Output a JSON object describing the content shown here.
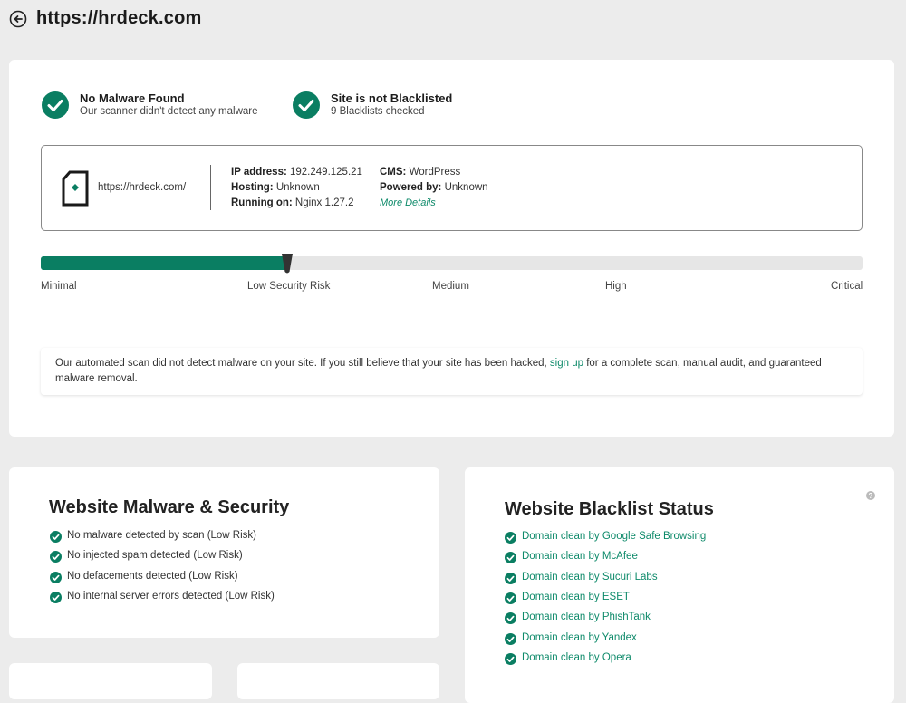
{
  "header": {
    "title": "https://hrdeck.com",
    "back_icon": "back-arrow-icon"
  },
  "status": {
    "malware": {
      "title": "No Malware Found",
      "subtitle": "Our scanner didn't detect any malware",
      "icon": "check-circle-icon"
    },
    "blacklist": {
      "title": "Site is not Blacklisted",
      "subtitle": "9 Blacklists checked",
      "icon": "check-circle-icon"
    }
  },
  "site_info": {
    "url": "https://hrdeck.com/",
    "ip_label": "IP address:",
    "ip_value": "192.249.125.21",
    "hosting_label": "Hosting:",
    "hosting_value": "Unknown",
    "running_label": "Running on:",
    "running_value": "Nginx 1.27.2",
    "cms_label": "CMS:",
    "cms_value": "WordPress",
    "powered_label": "Powered by:",
    "powered_value": "Unknown",
    "more_details": "More Details"
  },
  "risk": {
    "levels": [
      "Minimal",
      "Low Security Risk",
      "Medium",
      "High",
      "Critical"
    ],
    "current": "Low Security Risk",
    "fill_fraction": 0.3,
    "accent_color": "#0a7e62"
  },
  "notice": {
    "text_before": "Our automated scan did not detect malware on your site. If you still believe that your site has been hacked, ",
    "link_text": "sign up",
    "text_after": " for a complete scan, manual audit, and guaranteed malware removal."
  },
  "malware_section": {
    "title": "Website Malware & Security",
    "items": [
      "No malware detected by scan (Low Risk)",
      "No injected spam detected (Low Risk)",
      "No defacements detected (Low Risk)",
      "No internal server errors detected (Low Risk)"
    ]
  },
  "blacklist_section": {
    "title": "Website Blacklist Status",
    "help_icon": "question-circle-icon",
    "items": [
      "Domain clean by Google Safe Browsing",
      "Domain clean by McAfee",
      "Domain clean by Sucuri Labs",
      "Domain clean by ESET",
      "Domain clean by PhishTank",
      "Domain clean by Yandex",
      "Domain clean by Opera"
    ]
  }
}
